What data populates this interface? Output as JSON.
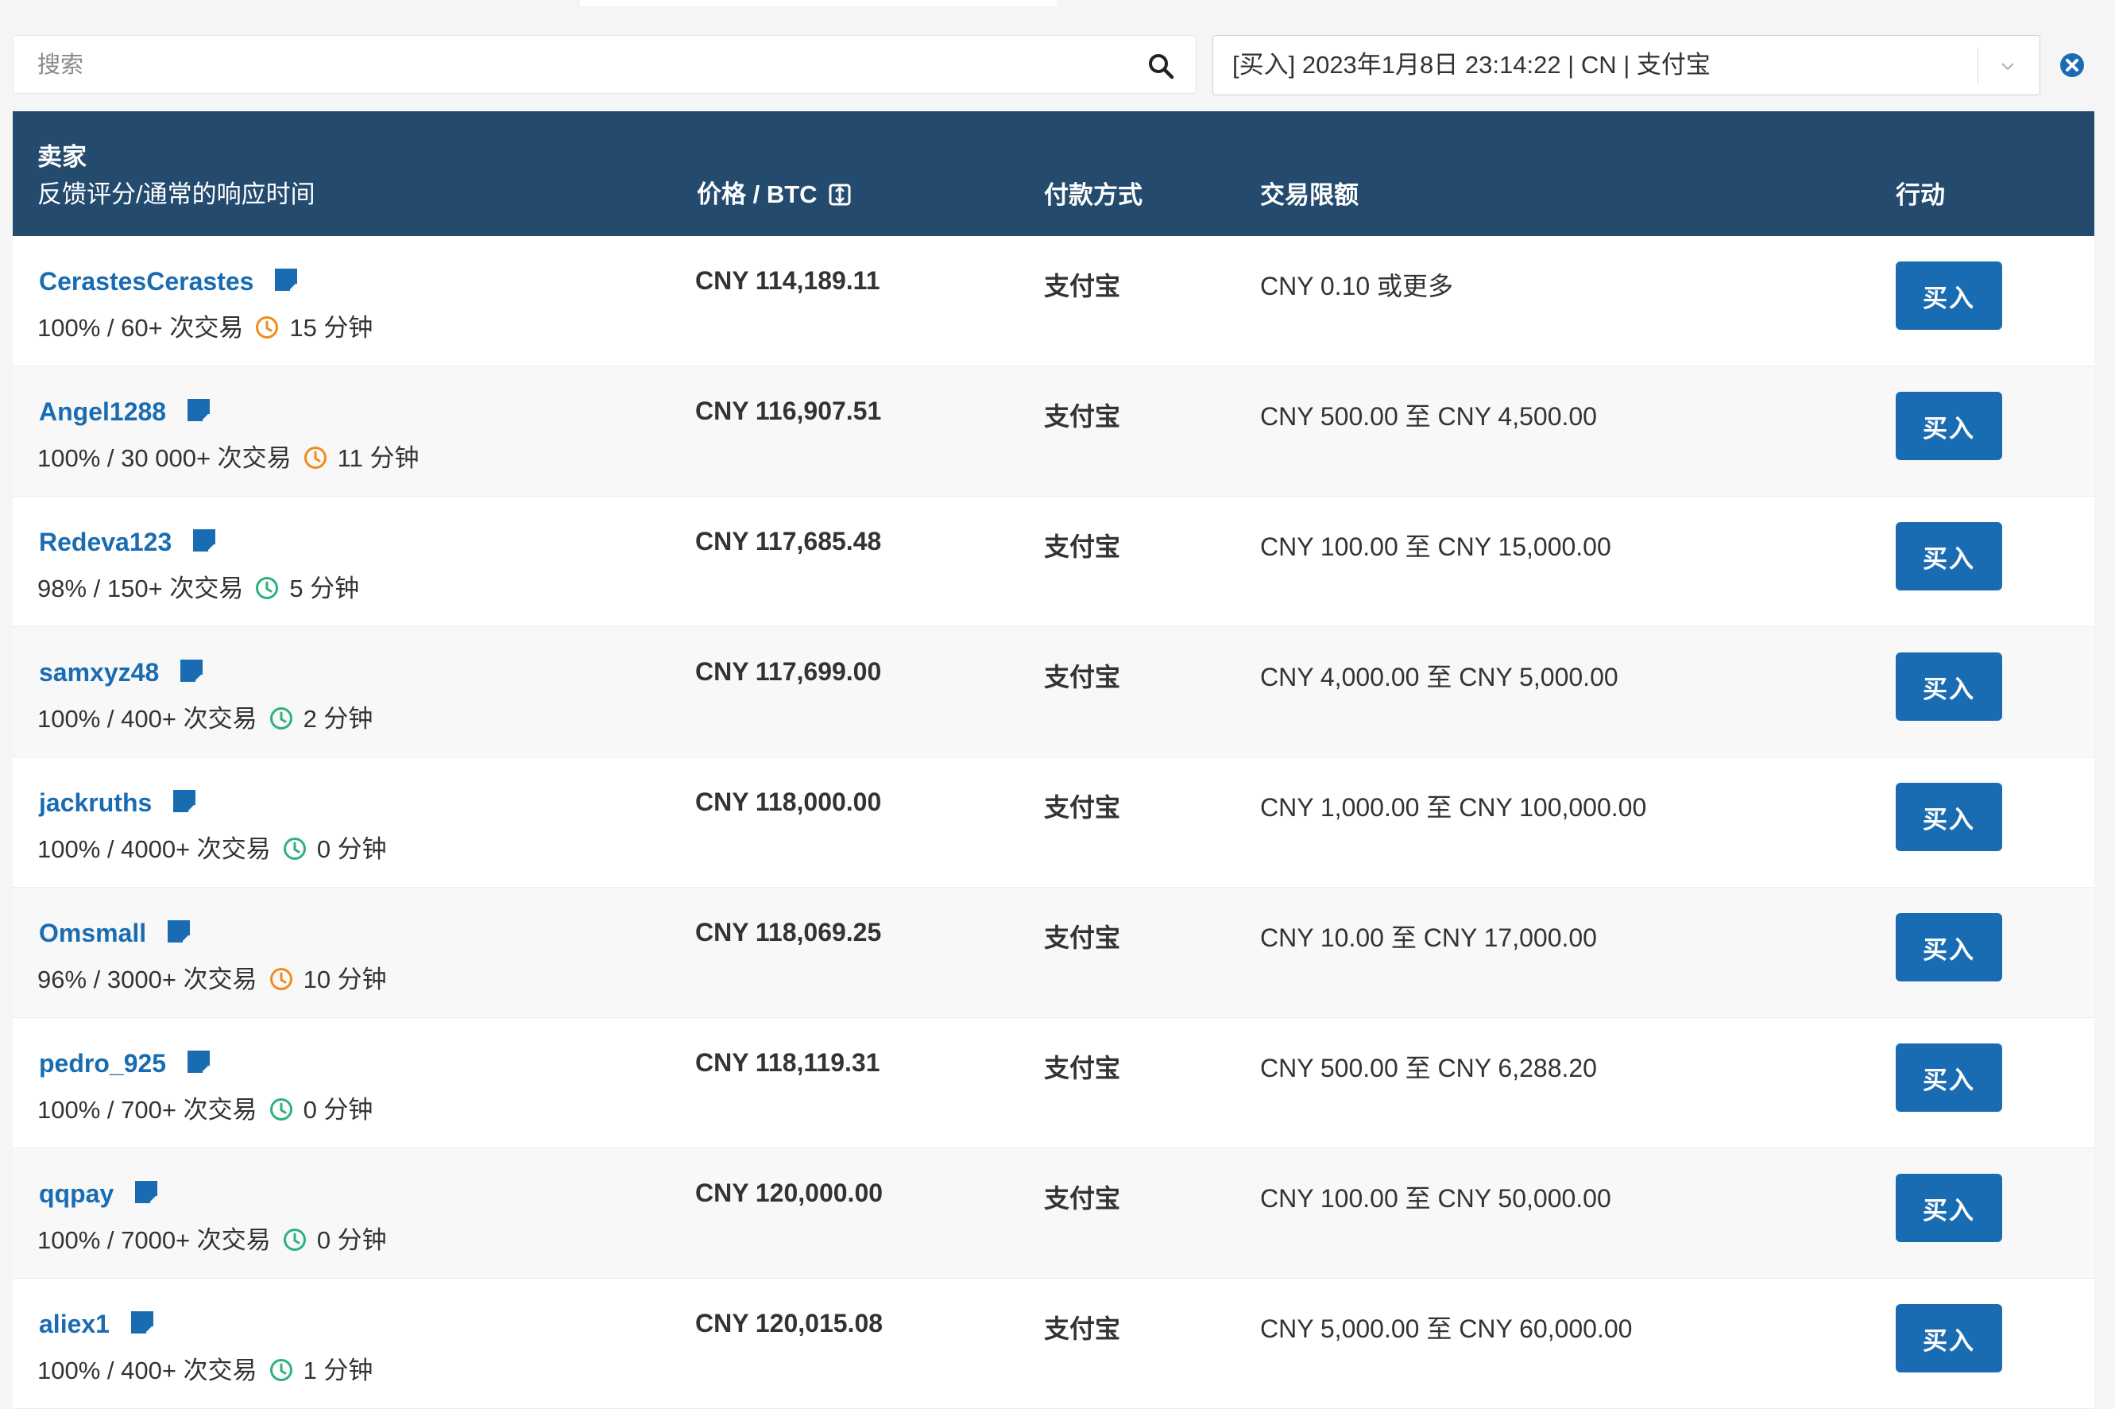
{
  "search": {
    "placeholder": "搜索"
  },
  "filter": {
    "selected": "[买入] 2023年1月8日 23:14:22 | CN | 支付宝"
  },
  "colors": {
    "header_bg": "#244b6e",
    "link": "#1a6cb2",
    "button": "#1a6cb2",
    "clock_orange": "#f08c1e",
    "clock_green": "#2db27d"
  },
  "table": {
    "headers": {
      "seller": "卖家",
      "seller_sub": "反馈评分/通常的响应时间",
      "price": "价格 / BTC",
      "payment": "付款方式",
      "limits": "交易限额",
      "action": "行动"
    },
    "rows": [
      {
        "seller": "CerastesCerastes",
        "stats": "100% / 60+ 次交易",
        "response": "15 分钟",
        "clock": "orange",
        "price": "CNY 114,189.11",
        "method": "支付宝",
        "limit": "CNY 0.10 或更多",
        "button": "买入"
      },
      {
        "seller": "Angel1288",
        "stats": "100% / 30 000+ 次交易",
        "response": "11 分钟",
        "clock": "orange",
        "price": "CNY 116,907.51",
        "method": "支付宝",
        "limit": "CNY 500.00 至 CNY 4,500.00",
        "button": "买入"
      },
      {
        "seller": "Redeva123",
        "stats": "98% / 150+ 次交易",
        "response": "5 分钟",
        "clock": "green",
        "price": "CNY 117,685.48",
        "method": "支付宝",
        "limit": "CNY 100.00 至 CNY 15,000.00",
        "button": "买入"
      },
      {
        "seller": "samxyz48",
        "stats": "100% / 400+ 次交易",
        "response": "2 分钟",
        "clock": "green",
        "price": "CNY 117,699.00",
        "method": "支付宝",
        "limit": "CNY 4,000.00 至 CNY 5,000.00",
        "button": "买入"
      },
      {
        "seller": "jackruths",
        "stats": "100% / 4000+ 次交易",
        "response": "0 分钟",
        "clock": "green",
        "price": "CNY 118,000.00",
        "method": "支付宝",
        "limit": "CNY 1,000.00 至 CNY 100,000.00",
        "button": "买入"
      },
      {
        "seller": "Omsmall",
        "stats": "96% / 3000+ 次交易",
        "response": "10 分钟",
        "clock": "orange",
        "price": "CNY 118,069.25",
        "method": "支付宝",
        "limit": "CNY 10.00 至 CNY 17,000.00",
        "button": "买入"
      },
      {
        "seller": "pedro_925",
        "stats": "100% / 700+ 次交易",
        "response": "0 分钟",
        "clock": "green",
        "price": "CNY 118,119.31",
        "method": "支付宝",
        "limit": "CNY 500.00 至 CNY 6,288.20",
        "button": "买入"
      },
      {
        "seller": "qqpay",
        "stats": "100% / 7000+ 次交易",
        "response": "0 分钟",
        "clock": "green",
        "price": "CNY 120,000.00",
        "method": "支付宝",
        "limit": "CNY 100.00 至 CNY 50,000.00",
        "button": "买入"
      },
      {
        "seller": "aliex1",
        "stats": "100% / 400+ 次交易",
        "response": "1 分钟",
        "clock": "green",
        "price": "CNY 120,015.08",
        "method": "支付宝",
        "limit": "CNY 5,000.00 至 CNY 60,000.00",
        "button": "买入"
      }
    ]
  }
}
